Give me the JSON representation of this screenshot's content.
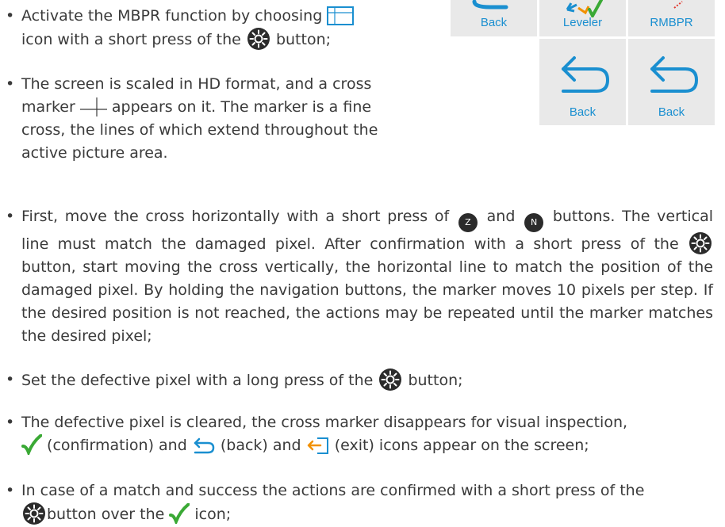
{
  "menu_grid": {
    "cells": [
      {
        "label": "Back",
        "icon": "back-arrow-icon"
      },
      {
        "label": "Leveler",
        "icon": "leveler-icon"
      },
      {
        "label": "RMBPR",
        "icon": "rmbpr-icon"
      },
      {
        "label": "Back",
        "icon": "back-arrow-icon"
      },
      {
        "label": "Back",
        "icon": "back-arrow-icon"
      }
    ],
    "accent": "#1a8fd0",
    "cell_bg": "#e9e9e9"
  },
  "bullets": {
    "b1": {
      "t1": "Activate the MBPR function by choosing",
      "t2": "icon with a short press of the",
      "t3": "button;"
    },
    "b2": {
      "t1": "The screen is scaled in HD format, and a cross",
      "t2": "marker",
      "t3": "appears on it. The marker is a fine",
      "t4": "cross, the lines of which extend throughout the",
      "t5": "active picture area."
    },
    "b3": {
      "t1": "First, move the cross horizontally with a short press of",
      "btn_z": "Z",
      "t2": "and",
      "btn_n": "N",
      "t3": "buttons. The vertical line must match the damaged pixel. After confirmation with a short press of the",
      "t4": "button, start moving the cross vertically, the horizontal line to match the position of the damaged pixel. By holding the navigation buttons, the marker moves 10 pixels per step. If the desired position is not reached, the actions may be repeated until the marker matches the desired pixel;"
    },
    "b4": {
      "t1": "Set the defective pixel with a long press of the",
      "t2": "button;"
    },
    "b5": {
      "t1": "The defective pixel is cleared, the cross marker disappears for visual inspection,",
      "t2": "(confirmation) and",
      "t3": "(back) and",
      "t4": "(exit) icons appear on the screen;"
    },
    "b6": {
      "t1": "In case of a match and success the actions are confirmed with a short press of the",
      "t2": "button over the",
      "t3": "icon;"
    }
  },
  "icons": {
    "bullet": "•",
    "check_color": "#3aa935",
    "back_color": "#1a8fd0",
    "exit_color": "#f29100"
  }
}
